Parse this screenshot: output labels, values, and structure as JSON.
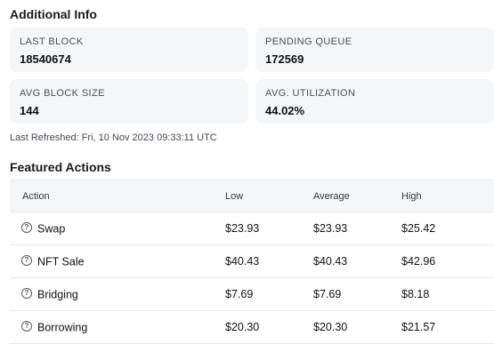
{
  "additional_info": {
    "title": "Additional Info",
    "cards": [
      {
        "label": "LAST BLOCK",
        "value": "18540674"
      },
      {
        "label": "PENDING QUEUE",
        "value": "172569"
      },
      {
        "label": "AVG BLOCK SIZE",
        "value": "144"
      },
      {
        "label": "AVG. UTILIZATION",
        "value": "44.02%"
      }
    ],
    "last_refreshed": "Last Refreshed: Fri, 10 Nov 2023 09:33:11 UTC"
  },
  "featured_actions": {
    "title": "Featured Actions",
    "columns": [
      "Action",
      "Low",
      "Average",
      "High"
    ],
    "rows": [
      {
        "action": "Swap",
        "low": "$23.93",
        "average": "$23.93",
        "high": "$25.42"
      },
      {
        "action": "NFT Sale",
        "low": "$40.43",
        "average": "$40.43",
        "high": "$42.96"
      },
      {
        "action": "Bridging",
        "low": "$7.69",
        "average": "$7.69",
        "high": "$8.18"
      },
      {
        "action": "Borrowing",
        "low": "$20.30",
        "average": "$20.30",
        "high": "$21.57"
      }
    ],
    "help_icon": "question-circle-icon",
    "help_glyph": "?"
  }
}
